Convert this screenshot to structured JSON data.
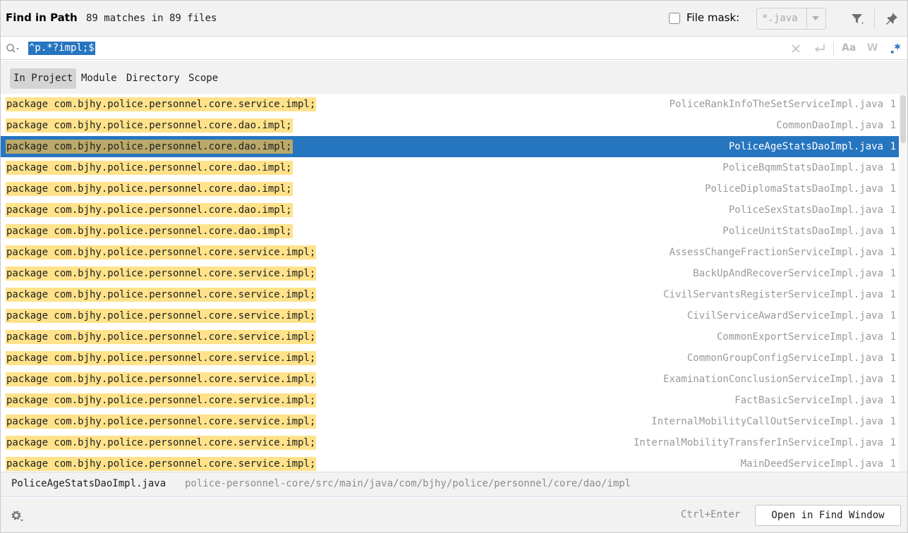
{
  "header": {
    "title": "Find in Path",
    "match_count": "89 matches in 89 files",
    "file_mask_label": "File mask:",
    "file_mask_value": "*.java",
    "file_mask_checked": false
  },
  "search": {
    "query": "^p.*?impl;$",
    "case_icon_label": "Aa",
    "word_icon_label": "W"
  },
  "scopes": [
    {
      "label": "In Project",
      "active": true
    },
    {
      "label": "Module",
      "active": false
    },
    {
      "label": "Directory",
      "active": false
    },
    {
      "label": "Scope",
      "active": false
    }
  ],
  "results": [
    {
      "match": "package com.bjhy.police.personnel.core.service.impl;",
      "file": "PoliceRankInfoTheSetServiceImpl.java",
      "line": "1",
      "selected": false
    },
    {
      "match": "package com.bjhy.police.personnel.core.dao.impl;",
      "file": "CommonDaoImpl.java",
      "line": "1",
      "selected": false
    },
    {
      "match": "package com.bjhy.police.personnel.core.dao.impl;",
      "file": "PoliceAgeStatsDaoImpl.java",
      "line": "1",
      "selected": true
    },
    {
      "match": "package com.bjhy.police.personnel.core.dao.impl;",
      "file": "PoliceBqmmStatsDaoImpl.java",
      "line": "1",
      "selected": false
    },
    {
      "match": "package com.bjhy.police.personnel.core.dao.impl;",
      "file": "PoliceDiplomaStatsDaoImpl.java",
      "line": "1",
      "selected": false
    },
    {
      "match": "package com.bjhy.police.personnel.core.dao.impl;",
      "file": "PoliceSexStatsDaoImpl.java",
      "line": "1",
      "selected": false
    },
    {
      "match": "package com.bjhy.police.personnel.core.dao.impl;",
      "file": "PoliceUnitStatsDaoImpl.java",
      "line": "1",
      "selected": false
    },
    {
      "match": "package com.bjhy.police.personnel.core.service.impl;",
      "file": "AssessChangeFractionServiceImpl.java",
      "line": "1",
      "selected": false
    },
    {
      "match": "package com.bjhy.police.personnel.core.service.impl;",
      "file": "BackUpAndRecoverServiceImpl.java",
      "line": "1",
      "selected": false
    },
    {
      "match": "package com.bjhy.police.personnel.core.service.impl;",
      "file": "CivilServantsRegisterServiceImpl.java",
      "line": "1",
      "selected": false
    },
    {
      "match": "package com.bjhy.police.personnel.core.service.impl;",
      "file": "CivilServiceAwardServiceImpl.java",
      "line": "1",
      "selected": false
    },
    {
      "match": "package com.bjhy.police.personnel.core.service.impl;",
      "file": "CommonExportServiceImpl.java",
      "line": "1",
      "selected": false
    },
    {
      "match": "package com.bjhy.police.personnel.core.service.impl;",
      "file": "CommonGroupConfigServiceImpl.java",
      "line": "1",
      "selected": false
    },
    {
      "match": "package com.bjhy.police.personnel.core.service.impl;",
      "file": "ExaminationConclusionServiceImpl.java",
      "line": "1",
      "selected": false
    },
    {
      "match": "package com.bjhy.police.personnel.core.service.impl;",
      "file": "FactBasicServiceImpl.java",
      "line": "1",
      "selected": false
    },
    {
      "match": "package com.bjhy.police.personnel.core.service.impl;",
      "file": "InternalMobilityCallOutServiceImpl.java",
      "line": "1",
      "selected": false
    },
    {
      "match": "package com.bjhy.police.personnel.core.service.impl;",
      "file": "InternalMobilityTransferInServiceImpl.java",
      "line": "1",
      "selected": false
    },
    {
      "match": "package com.bjhy.police.personnel.core.service.impl;",
      "file": "MainDeedServiceImpl.java",
      "line": "1",
      "selected": false
    }
  ],
  "preview": {
    "file": "PoliceAgeStatsDaoImpl.java",
    "path": "police-personnel-core/src/main/java/com/bjhy/police/personnel/core/dao/impl"
  },
  "footer": {
    "shortcut": "Ctrl+Enter",
    "open_button": "Open in Find Window"
  },
  "colors": {
    "selection": "#2675bf",
    "match_highlight": "#ffe28a"
  },
  "icons": {
    "filter": "filter-icon",
    "pin": "pin-icon",
    "search": "search-icon",
    "clear": "close-icon",
    "newline": "newline-icon",
    "regex": "regex-icon",
    "settings": "gear-icon"
  }
}
